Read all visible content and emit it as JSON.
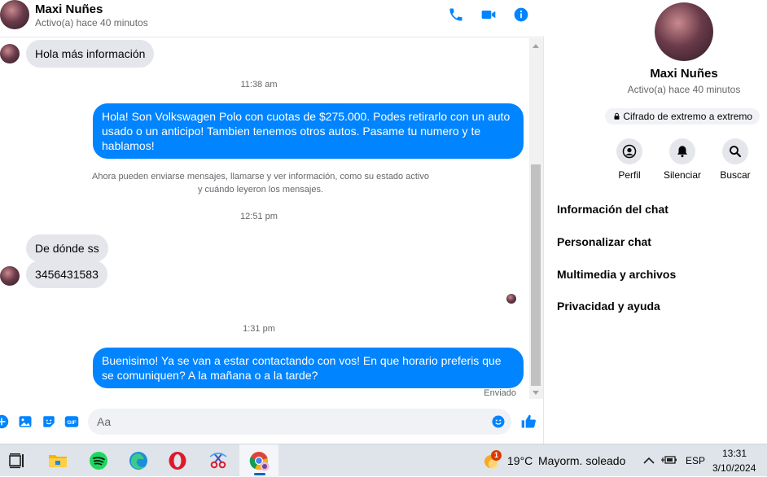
{
  "chat": {
    "contact_name": "Maxi Nuñes",
    "contact_status": "Activo(a) hace 40 minutos",
    "header_icons": [
      "phone-icon",
      "video-icon",
      "info-icon"
    ],
    "messages": [
      {
        "type": "in",
        "text": "Hola más información"
      },
      {
        "type": "timestamp",
        "text": "11:38 am"
      },
      {
        "type": "out",
        "text": "Hola! Son Volkswagen Polo con cuotas de $275.000. Podes retirarlo con un auto usado o un anticipo! Tambien tenemos otros autos. Pasame tu numero y te hablamos!"
      },
      {
        "type": "system",
        "line1": "Ahora pueden enviarse mensajes, llamarse y ver información, como su estado activo",
        "line2": "y cuándo leyeron los mensajes."
      },
      {
        "type": "timestamp",
        "text": "12:51 pm"
      },
      {
        "type": "in",
        "text": "De dónde ss"
      },
      {
        "type": "in",
        "text": "3456431583"
      },
      {
        "type": "timestamp",
        "text": "1:31 pm"
      },
      {
        "type": "out",
        "text": "Buenisimo! Ya se van a estar contactando con vos! En que horario preferis que se comuniquen? A la mañana o a la tarde?"
      },
      {
        "type": "receipt",
        "text": "Enviado"
      }
    ],
    "composer": {
      "placeholder": "Aa",
      "icons": [
        "plus-icon",
        "image-icon",
        "sticker-icon",
        "gif-icon",
        "emoji-icon",
        "thumbs-up-icon"
      ]
    }
  },
  "info_panel": {
    "name": "Maxi Nuñes",
    "status": "Activo(a) hace 40 minutos",
    "encryption": "Cifrado de extremo a extremo",
    "actions": [
      {
        "label": "Perfil",
        "icon": "profile-icon"
      },
      {
        "label": "Silenciar",
        "icon": "bell-icon"
      },
      {
        "label": "Buscar",
        "icon": "search-icon"
      }
    ],
    "menu": [
      "Información del chat",
      "Personalizar chat",
      "Multimedia y archivos",
      "Privacidad y ayuda"
    ]
  },
  "taskbar": {
    "apps": [
      "task-view-icon",
      "file-explorer-icon",
      "spotify-icon",
      "edge-icon",
      "opera-icon",
      "snipping-tool-icon",
      "chrome-icon"
    ],
    "weather_badge": "1",
    "weather_temp": "19°C",
    "weather_desc": "Mayorm. soleado",
    "language": "ESP",
    "time": "13:31",
    "date": "3/10/2024"
  },
  "colors": {
    "accent": "#0084ff",
    "bubble_in": "#e4e6eb",
    "text_secondary": "#65676b"
  }
}
